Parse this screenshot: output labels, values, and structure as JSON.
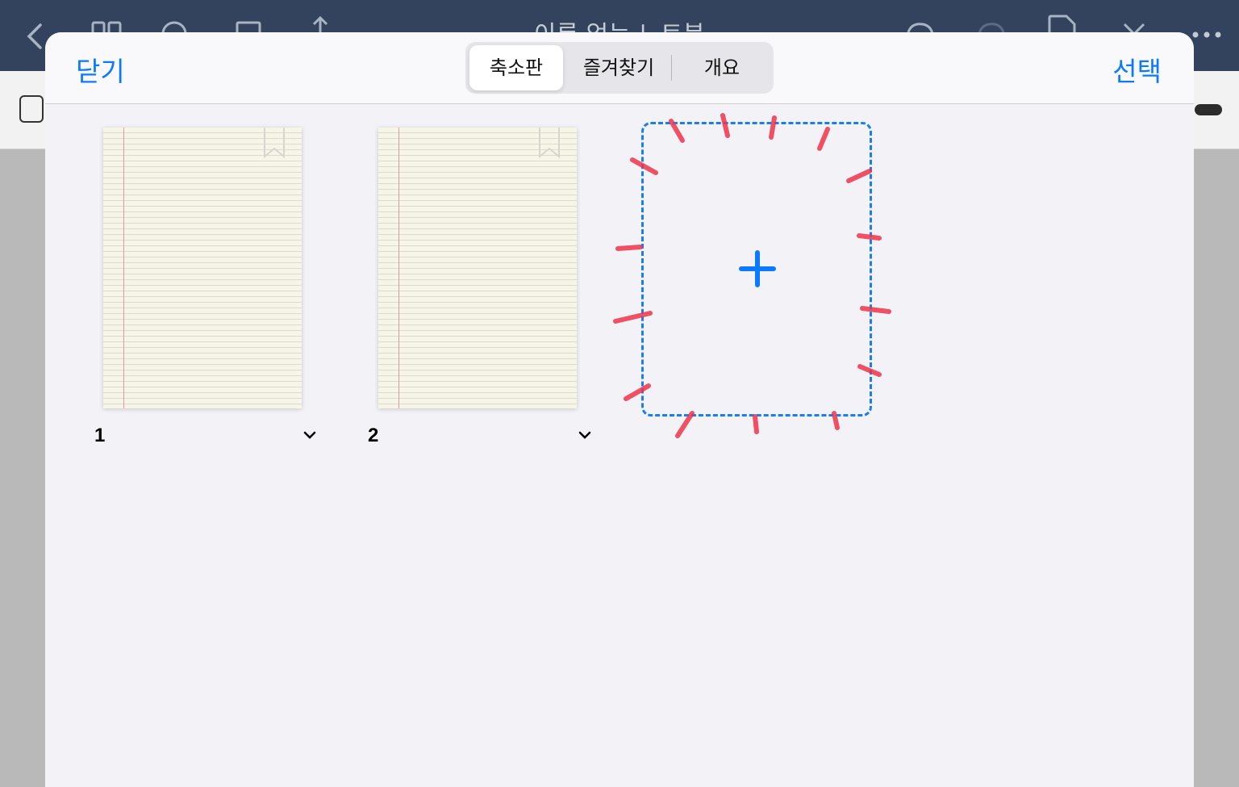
{
  "background": {
    "title": "이름 없는 노트북"
  },
  "sheet": {
    "close_label": "닫기",
    "select_label": "선택",
    "tabs": [
      {
        "label": "축소판",
        "active": true
      },
      {
        "label": "즐겨찾기",
        "active": false
      },
      {
        "label": "개요",
        "active": false
      }
    ],
    "pages": [
      {
        "number": "1",
        "bookmark_icon": "bookmark-icon",
        "chevron_icon": "chevron-down-icon"
      },
      {
        "number": "2",
        "bookmark_icon": "bookmark-icon",
        "chevron_icon": "chevron-down-icon"
      }
    ],
    "add_page_icon": "plus-icon"
  },
  "colors": {
    "accent": "#0a7aff",
    "header_bar": "#33435e",
    "paper": "#f7f5e8",
    "scribble": "#f0344a"
  }
}
